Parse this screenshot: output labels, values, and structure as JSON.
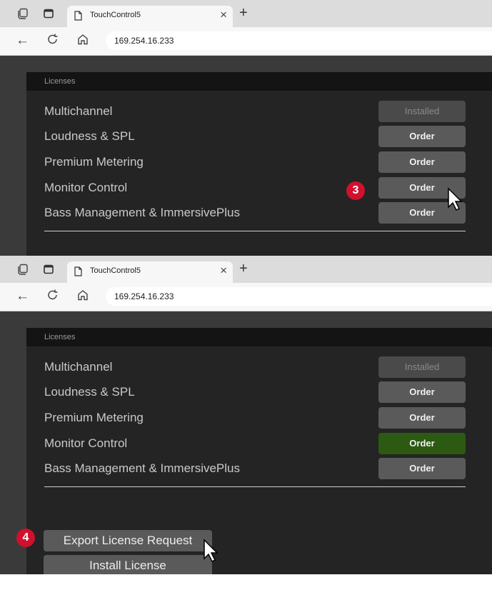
{
  "screenshots": [
    {
      "tab_title": "TouchControl5",
      "url": "169.254.16.233",
      "panel_title": "Licenses",
      "licenses": [
        {
          "name": "Multichannel",
          "button": "Installed"
        },
        {
          "name": "Loudness & SPL",
          "button": "Order"
        },
        {
          "name": "Premium Metering",
          "button": "Order"
        },
        {
          "name": "Monitor Control",
          "button": "Order"
        },
        {
          "name": "Bass Management & ImmersivePlus",
          "button": "Order"
        }
      ],
      "step_marker": "3"
    },
    {
      "tab_title": "TouchControl5",
      "url": "169.254.16.233",
      "panel_title": "Licenses",
      "licenses": [
        {
          "name": "Multichannel",
          "button": "Installed"
        },
        {
          "name": "Loudness & SPL",
          "button": "Order"
        },
        {
          "name": "Premium Metering",
          "button": "Order"
        },
        {
          "name": "Monitor Control",
          "button": "Order"
        },
        {
          "name": "Bass Management & ImmersivePlus",
          "button": "Order"
        }
      ],
      "actions": {
        "export_label": "Export License Request",
        "install_label": "Install License"
      },
      "step_marker": "4"
    }
  ],
  "icons": {
    "tab_actions": "tab-actions-icon",
    "vertical_tabs": "vertical-tabs-icon",
    "page": "page-icon",
    "close": "close-icon",
    "new_tab": "new-tab-icon",
    "back": "back-arrow-icon",
    "refresh": "refresh-icon",
    "home": "home-icon",
    "cursor": "mouse-pointer-icon"
  },
  "colors": {
    "accent_marker": "#d0102e",
    "selected_order": "#2d5a12"
  }
}
